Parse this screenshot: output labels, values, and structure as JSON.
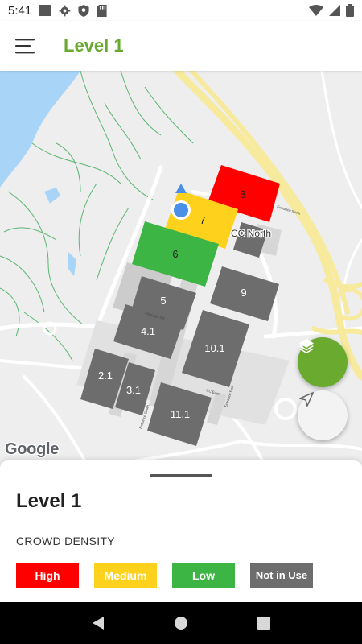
{
  "status_bar": {
    "time": "5:41",
    "icons": [
      "square-icon",
      "gear-icon",
      "shield-icon",
      "sd-card-icon",
      "wifi-icon",
      "signal-icon",
      "battery-icon"
    ]
  },
  "app_bar": {
    "title": "Level 1",
    "menu_icon": "menu-icon"
  },
  "map": {
    "halls": [
      {
        "id": "8",
        "label": "8",
        "status": "High"
      },
      {
        "id": "7",
        "label": "7",
        "status": "Medium"
      },
      {
        "id": "6",
        "label": "6",
        "status": "Low"
      },
      {
        "id": "5",
        "label": "5",
        "status": "Not in Use"
      },
      {
        "id": "4.1",
        "label": "4.1",
        "status": "Not in Use"
      },
      {
        "id": "9",
        "label": "9",
        "status": "Not in Use"
      },
      {
        "id": "10.1",
        "label": "10.1",
        "status": "Not in Use"
      },
      {
        "id": "2.1",
        "label": "2.1",
        "status": "Not in Use"
      },
      {
        "id": "3.1",
        "label": "3.1",
        "status": "Not in Use"
      },
      {
        "id": "11.1",
        "label": "11.1",
        "status": "Not in Use"
      }
    ],
    "place_label": "CC North",
    "small_labels": {
      "passage": "Passage 4-5",
      "entrance_north": "Entrance North",
      "cc_east": "CC East",
      "entrance_east": "Entrance East",
      "walkway": "Entrance South"
    },
    "attribution": "Google",
    "layers_button_icon": "layers-icon",
    "locate_button_icon": "navigation-arrow-icon"
  },
  "sheet": {
    "title": "Level 1",
    "section_label": "CROWD DENSITY",
    "legend": [
      {
        "label": "High",
        "color": "#ff0000"
      },
      {
        "label": "Medium",
        "color": "#fed11c"
      },
      {
        "label": "Low",
        "color": "#3cb545"
      },
      {
        "label": "Not in Use",
        "color": "#6d6d6d"
      }
    ]
  },
  "nav_bar": {
    "icons": [
      "back-icon",
      "home-icon",
      "recents-icon"
    ]
  },
  "colors": {
    "accent": "#6aaa2e",
    "high": "#ff0000",
    "medium": "#fed11c",
    "low": "#3cb545",
    "not_in_use": "#6d6d6d"
  }
}
